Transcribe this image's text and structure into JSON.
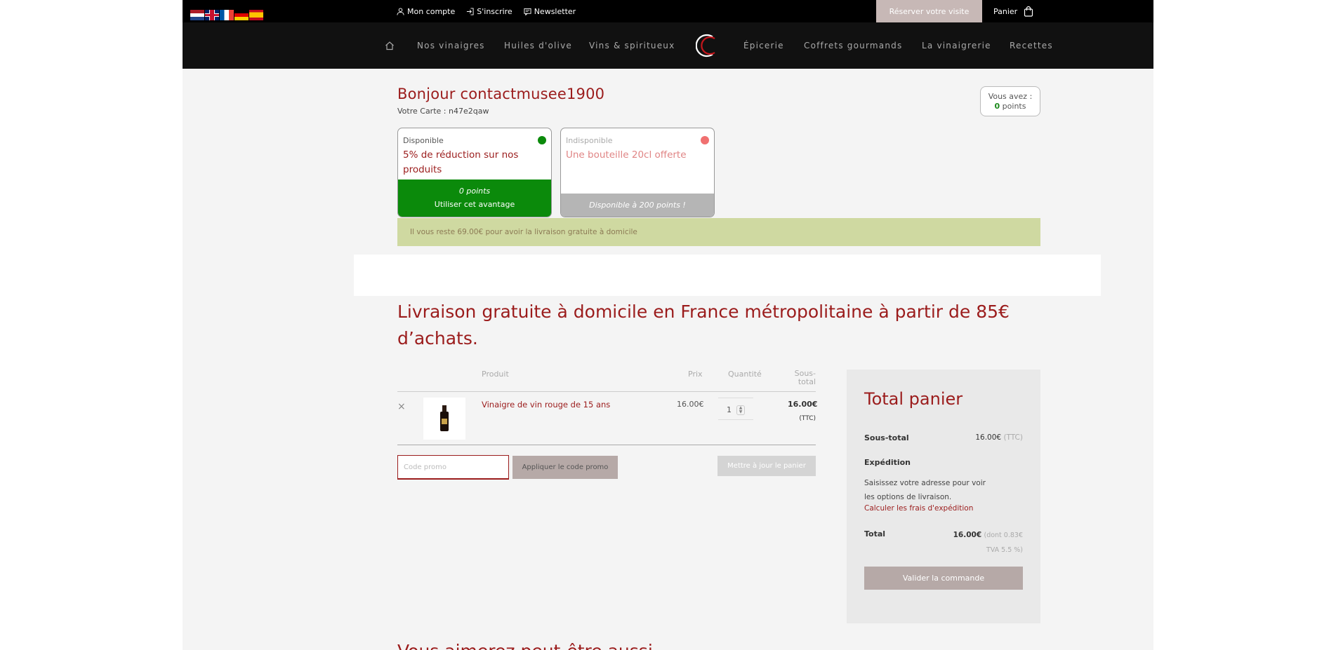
{
  "topbar": {
    "links": {
      "account": "Mon compte",
      "register": "S'inscrire",
      "newsletter": "Newsletter"
    },
    "visit_button": "Réserver votre visite",
    "cart_label": "Panier"
  },
  "nav": {
    "items": [
      "Nos vinaigres",
      "Huiles d'olive",
      "Vins & spiritueux",
      "Épicerie",
      "Coffrets gourmands",
      "La vinaigrerie",
      "Recettes"
    ]
  },
  "account": {
    "greeting": "Bonjour contactmusee1900",
    "card": "Votre Carte : n47e2qaw",
    "points_label": "Vous avez :",
    "points_value": "0",
    "points_unit": "points"
  },
  "advantages": [
    {
      "status": "Disponible",
      "title": "5% de réduction sur nos produits",
      "points": "0 points",
      "action": "Utiliser cet avantage",
      "dot_color": "#0b8a0b"
    },
    {
      "status": "Indisponible",
      "title": "Une bouteille 20cl offerte",
      "footer": "Disponible à 200 points !",
      "dot_color": "#f07070"
    }
  ],
  "notice": "Il vous reste 69.00€ pour avoir la livraison gratuite à domicile",
  "headline": "Livraison gratuite à domicile en France métropolitaine à partir de 85€ d’achats.",
  "cart": {
    "headers": {
      "product": "Produit",
      "price": "Prix",
      "quantity": "Quantité",
      "subtotal": "Sous-total"
    },
    "items": [
      {
        "remove": "×",
        "name": "Vinaigre de vin rouge de 15 ans",
        "price": "16.00€",
        "quantity": "1",
        "subtotal": "16.00€",
        "tax_note": "(TTC)"
      }
    ],
    "promo_placeholder": "Code promo",
    "promo_button": "Appliquer le code promo",
    "update_button": "Mettre à jour le panier"
  },
  "totals": {
    "title": "Total panier",
    "subtotal_label": "Sous-total",
    "subtotal_value": "16.00€",
    "subtotal_suffix": "(TTC)",
    "shipping_label": "Expédition",
    "shipping_text": "Saisissez votre adresse pour voir les options de livraison.",
    "shipping_link": "Calculer les frais d'expédition",
    "total_label": "Total",
    "total_value": "16.00€",
    "total_suffix": "(dont 0.83€ TVA 5.5 %)",
    "checkout_button": "Valider la commande"
  },
  "bottom_heading": "Vous aimerez peut-être aussi…",
  "colors": {
    "brand_red": "#9b1c1c",
    "available_green": "#0b8a0b",
    "unavailable_red": "#f07070",
    "notice_bg": "#cfd9a1",
    "button_taupe": "#b6a9a7"
  }
}
